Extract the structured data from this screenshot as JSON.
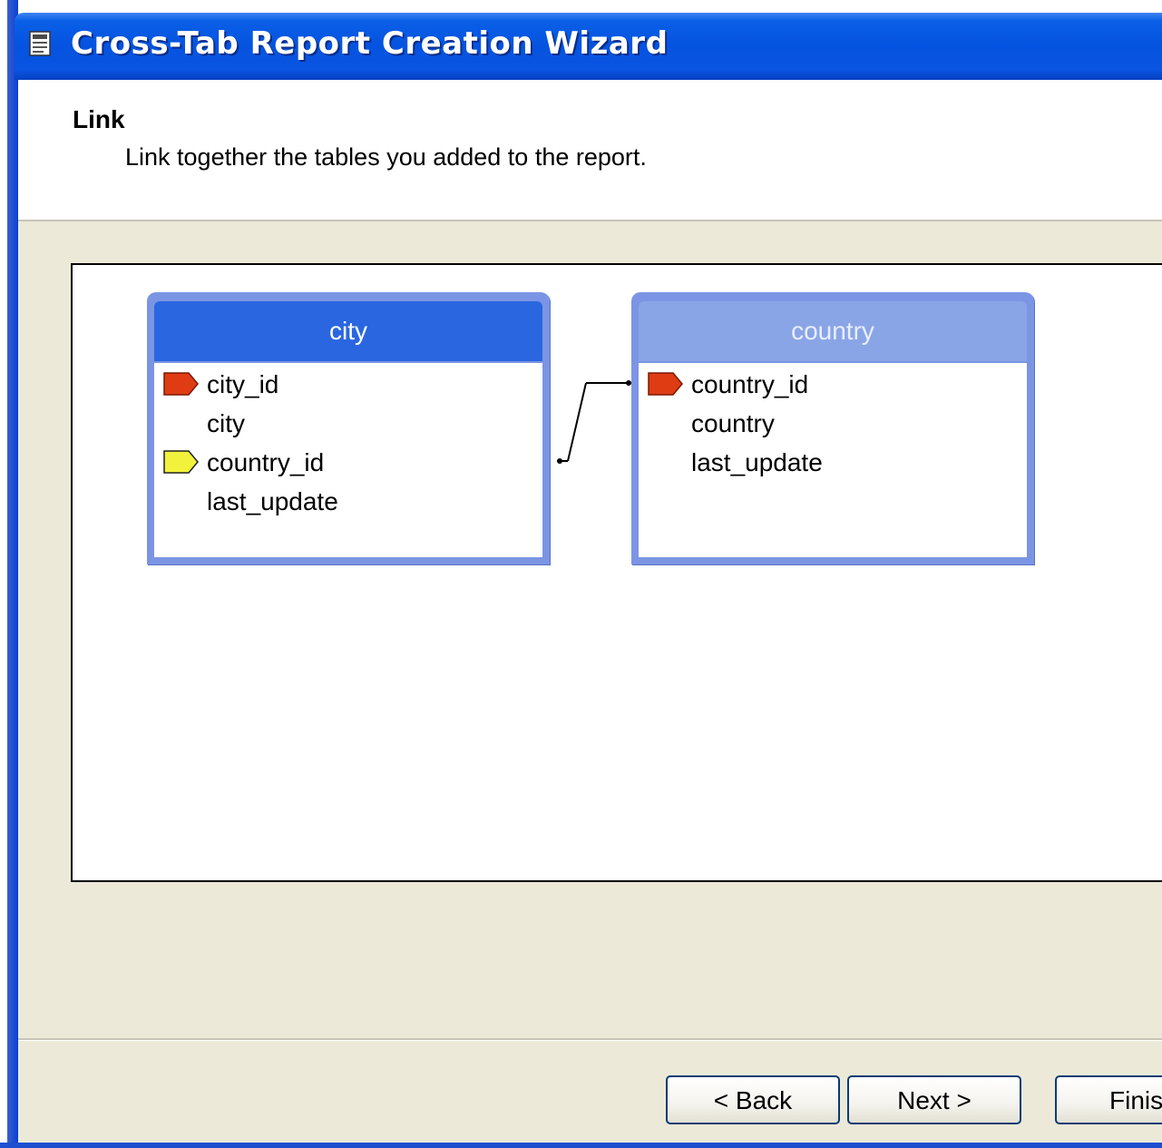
{
  "window": {
    "title": "Cross-Tab Report Creation Wizard",
    "icon": "report-wizard-icon"
  },
  "header": {
    "title": "Link",
    "subtitle": "Link together the tables you added to the report."
  },
  "tables": [
    {
      "name": "city",
      "active": true,
      "fields": [
        {
          "label": "city_id",
          "key": "primary"
        },
        {
          "label": "city",
          "key": "none"
        },
        {
          "label": "country_id",
          "key": "foreign"
        },
        {
          "label": "last_update",
          "key": "none"
        }
      ]
    },
    {
      "name": "country",
      "active": false,
      "fields": [
        {
          "label": "country_id",
          "key": "primary"
        },
        {
          "label": "country",
          "key": "none"
        },
        {
          "label": "last_update",
          "key": "none"
        }
      ]
    }
  ],
  "link": {
    "from": "city.country_id",
    "to": "country.country_id"
  },
  "buttons": {
    "back": "< Back",
    "next": "Next >",
    "finish": "Finis"
  },
  "colors": {
    "primary_key": "#e03c14",
    "foreign_key": "#f2f23c",
    "title_bar": "#0553e0",
    "table_border": "#7b95e4"
  }
}
